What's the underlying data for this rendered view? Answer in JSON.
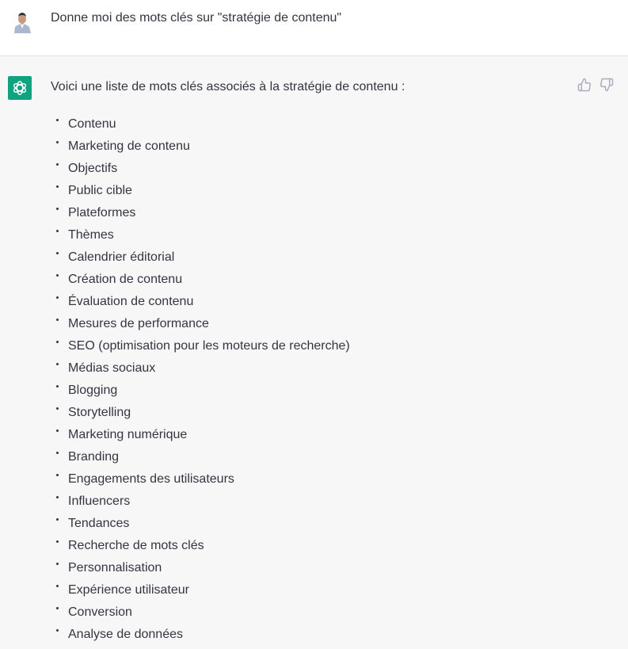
{
  "user_message": {
    "avatar": "user-avatar-photo",
    "text": "Donne moi des mots clés sur \"stratégie de contenu\""
  },
  "assistant_message": {
    "avatar": "chatgpt-logo-icon",
    "brand_color": "#10a37f",
    "intro": "Voici une liste de mots clés associés à la stratégie de contenu :",
    "feedback": [
      "thumbs-up-icon",
      "thumbs-down-icon"
    ],
    "keywords": [
      "Contenu",
      "Marketing de contenu",
      "Objectifs",
      "Public cible",
      "Plateformes",
      "Thèmes",
      "Calendrier éditorial",
      "Création de contenu",
      "Évaluation de contenu",
      "Mesures de performance",
      "SEO (optimisation pour les moteurs de recherche)",
      "Médias sociaux",
      "Blogging",
      "Storytelling",
      "Marketing numérique",
      "Branding",
      "Engagements des utilisateurs",
      "Influencers",
      "Tendances",
      "Recherche de mots clés",
      "Personnalisation",
      "Expérience utilisateur",
      "Conversion",
      "Analyse de données"
    ]
  }
}
